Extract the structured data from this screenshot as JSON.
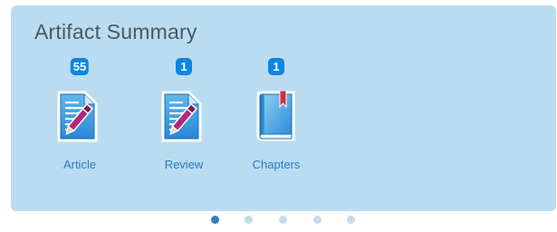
{
  "panel": {
    "title": "Artifact Summary"
  },
  "items": [
    {
      "label": "Article",
      "count": "55",
      "icon": "document-pen-icon"
    },
    {
      "label": "Review",
      "count": "1",
      "icon": "document-pen-icon"
    },
    {
      "label": "Chapters",
      "count": "1",
      "icon": "book-icon"
    }
  ],
  "pagination": {
    "pages": 5,
    "active_page": 1
  },
  "colors": {
    "panel_bg": "#b9dcf1",
    "badge": "#0b86e3",
    "label": "#2a79c9",
    "title": "#4d5763",
    "dot_active": "#2e7fbd",
    "dot_inactive": "#c8dbe8"
  }
}
